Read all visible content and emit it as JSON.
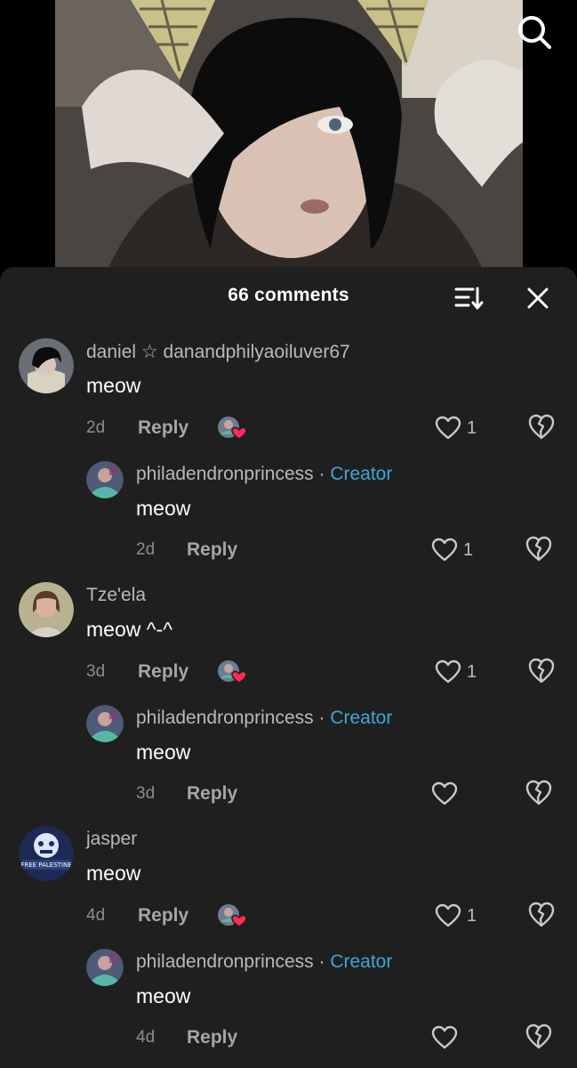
{
  "header": {
    "comment_count_label": "66 comments"
  },
  "comments": [
    {
      "username": "daniel ☆ danandphilyaoiluver67",
      "text": "meow",
      "time": "2d",
      "reply_label": "Reply",
      "likes": "1",
      "creator_liked": true,
      "reply": {
        "username": "philadendronprincess",
        "separator": "·",
        "creator_label": "Creator",
        "text": "meow",
        "time": "2d",
        "reply_label": "Reply",
        "likes": "1"
      }
    },
    {
      "username": "Tze'ela",
      "text": "meow ^-^",
      "time": "3d",
      "reply_label": "Reply",
      "likes": "1",
      "creator_liked": true,
      "reply": {
        "username": "philadendronprincess",
        "separator": "·",
        "creator_label": "Creator",
        "text": "meow",
        "time": "3d",
        "reply_label": "Reply",
        "likes": ""
      }
    },
    {
      "username": "jasper",
      "text": "meow",
      "time": "4d",
      "reply_label": "Reply",
      "likes": "1",
      "creator_liked": true,
      "avatar_text": "FREE PALESTINE",
      "reply": {
        "username": "philadendronprincess",
        "separator": "·",
        "creator_label": "Creator",
        "text": "meow",
        "time": "4d",
        "reply_label": "Reply",
        "likes": ""
      }
    }
  ],
  "colors": {
    "sheet_bg": "#1f1f1f",
    "creator_accent": "#3fa6d8",
    "heart_badge": "#fe2c55"
  },
  "icons": [
    "search-icon",
    "sort-icon",
    "close-icon",
    "heart-icon",
    "broken-heart-icon"
  ]
}
